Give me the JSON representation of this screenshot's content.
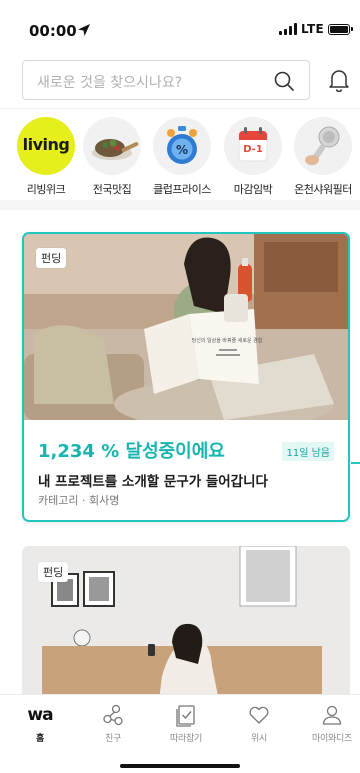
{
  "status_bar": {
    "time": "00:00",
    "network": "LTE"
  },
  "search": {
    "placeholder": "새로운 것을 찾으시나요?"
  },
  "categories": [
    {
      "label": "리빙위크",
      "badge": "living"
    },
    {
      "label": "전국맛집"
    },
    {
      "label": "클럽프라이스"
    },
    {
      "label": "마감임박",
      "badge": "D-1"
    },
    {
      "label": "온천샤워필터"
    }
  ],
  "card1": {
    "tag": "펀딩",
    "achievement": "1,234 % 달성중이에요",
    "days_left": "11일 남음",
    "title": "내 프로젝트를 소개할 문구가 들어갑니다",
    "meta": "카테고리 · 회사명",
    "booklet_text": "당신의 일상을 바꿔줄 새로운 경험"
  },
  "card2": {
    "tag": "펀딩"
  },
  "tabbar": {
    "items": [
      {
        "label": "홈",
        "logo": "wa"
      },
      {
        "label": "친구"
      },
      {
        "label": "따라잡기"
      },
      {
        "label": "위시"
      },
      {
        "label": "마이와디즈"
      }
    ]
  },
  "colors": {
    "accent": "#21c7bf",
    "accent_text": "#16b5ad",
    "living_badge": "#e6ee1c",
    "d1_badge": "#e8453c"
  }
}
